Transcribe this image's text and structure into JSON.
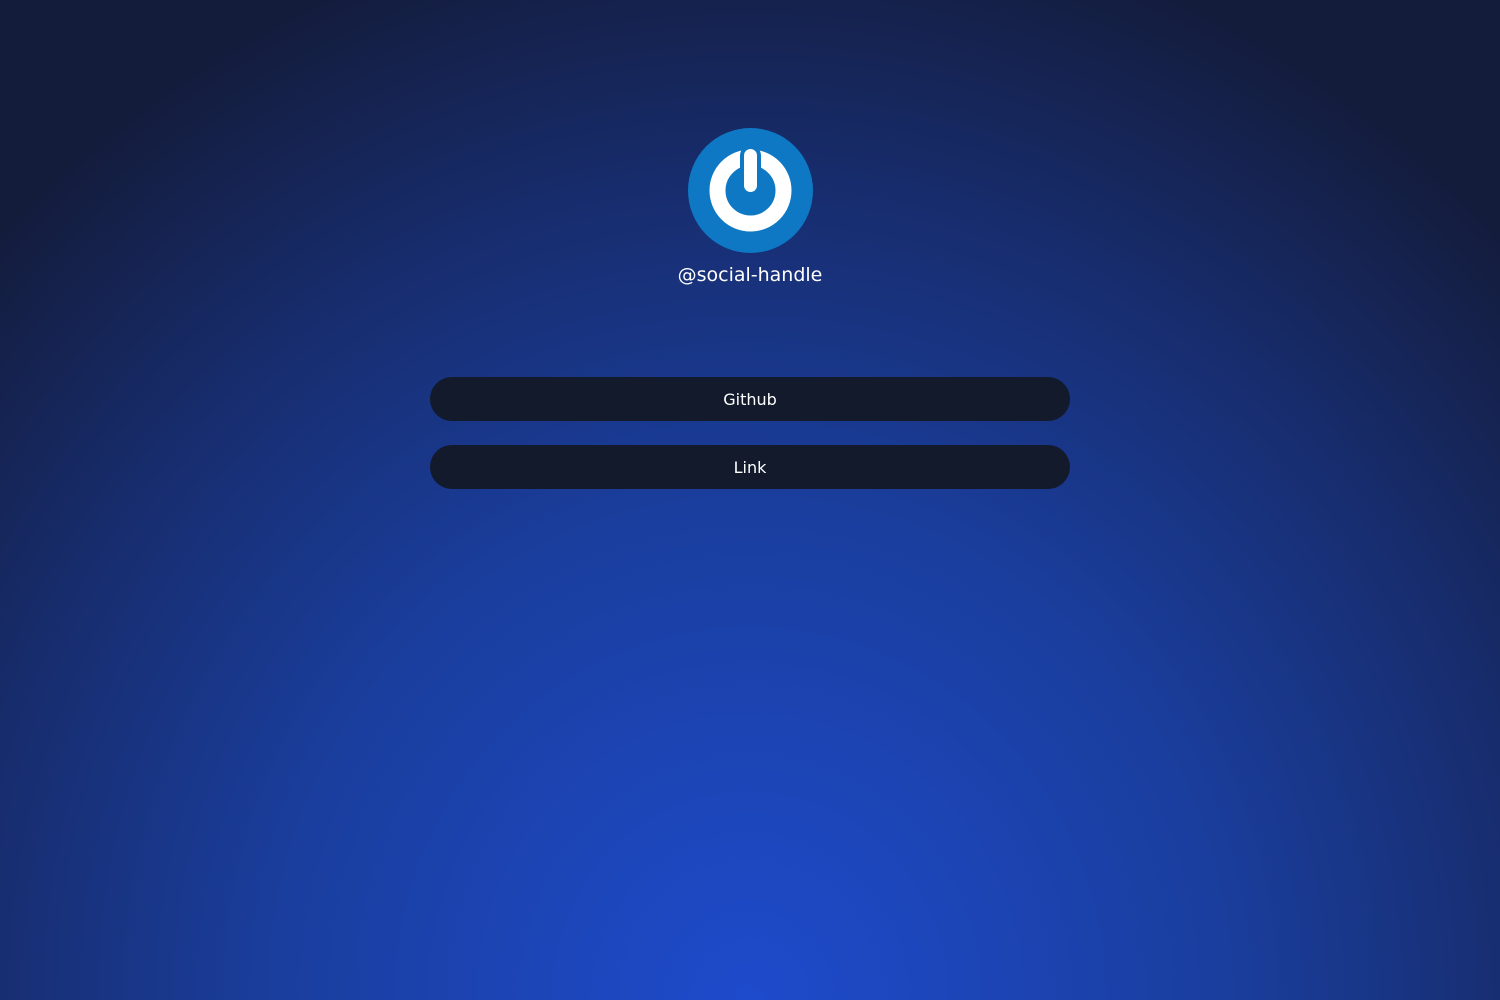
{
  "profile": {
    "avatar_icon": "power-icon",
    "avatar_color": "#0e78c4",
    "handle": "@social-handle"
  },
  "links": [
    {
      "label": "Github"
    },
    {
      "label": "Link"
    }
  ],
  "colors": {
    "button_background": "#121a2c",
    "background_center": "#1e4bcc",
    "background_edge": "#141c3c"
  }
}
